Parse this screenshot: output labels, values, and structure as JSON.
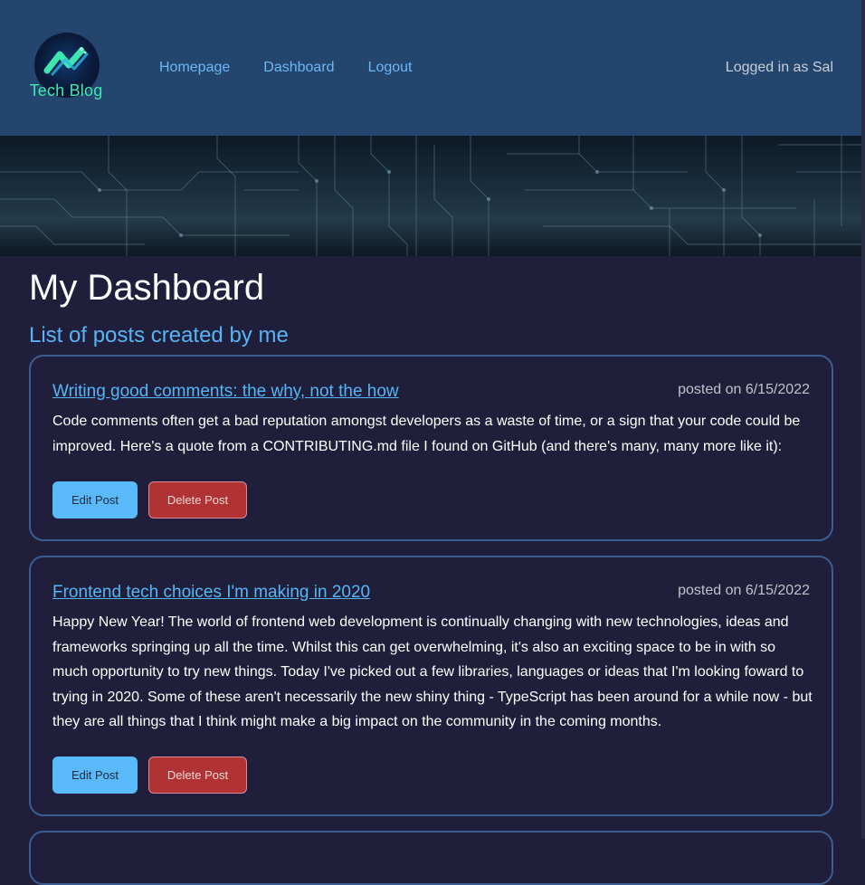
{
  "brand": {
    "name": "Tech Blog",
    "logo_icon": "tech-blog-logo-icon"
  },
  "nav": {
    "items": [
      {
        "label": "Homepage"
      },
      {
        "label": "Dashboard"
      },
      {
        "label": "Logout"
      }
    ]
  },
  "user_status": "Logged in as Sal",
  "page": {
    "title": "My Dashboard",
    "subtitle": "List of posts created by me"
  },
  "posts": [
    {
      "title": "Writing good comments: the why, not the how",
      "date": "posted on 6/15/2022",
      "body": "Code comments often get a bad reputation amongst developers as a waste of time, or a sign that your code could be improved. Here's a quote from a CONTRIBUTING.md file I found on GitHub (and there's many, many more like it):",
      "edit_label": "Edit Post",
      "delete_label": "Delete Post"
    },
    {
      "title": "Frontend tech choices I'm making in 2020",
      "date": "posted on 6/15/2022",
      "body": "Happy New Year! The world of frontend web development is continually changing with new technologies, ideas and frameworks springing up all the time. Whilst this can get overwhelming, it's also an exciting space to be in with so much opportunity to try new things. Today I've picked out a few libraries, languages or ideas that I'm looking foward to trying in 2020. Some of these aren't necessarily the new shiny thing - TypeScript has been around for a while now - but they are all things that I think might make a big impact on the community in the coming months.",
      "edit_label": "Edit Post",
      "delete_label": "Delete Post"
    }
  ],
  "colors": {
    "header_bg": "#24456e",
    "page_bg": "#1f1f3b",
    "link": "#6cb8f5",
    "edit_button": "#5ab9f8",
    "delete_button": "#b03232",
    "card_border": "#3c5d8f"
  }
}
